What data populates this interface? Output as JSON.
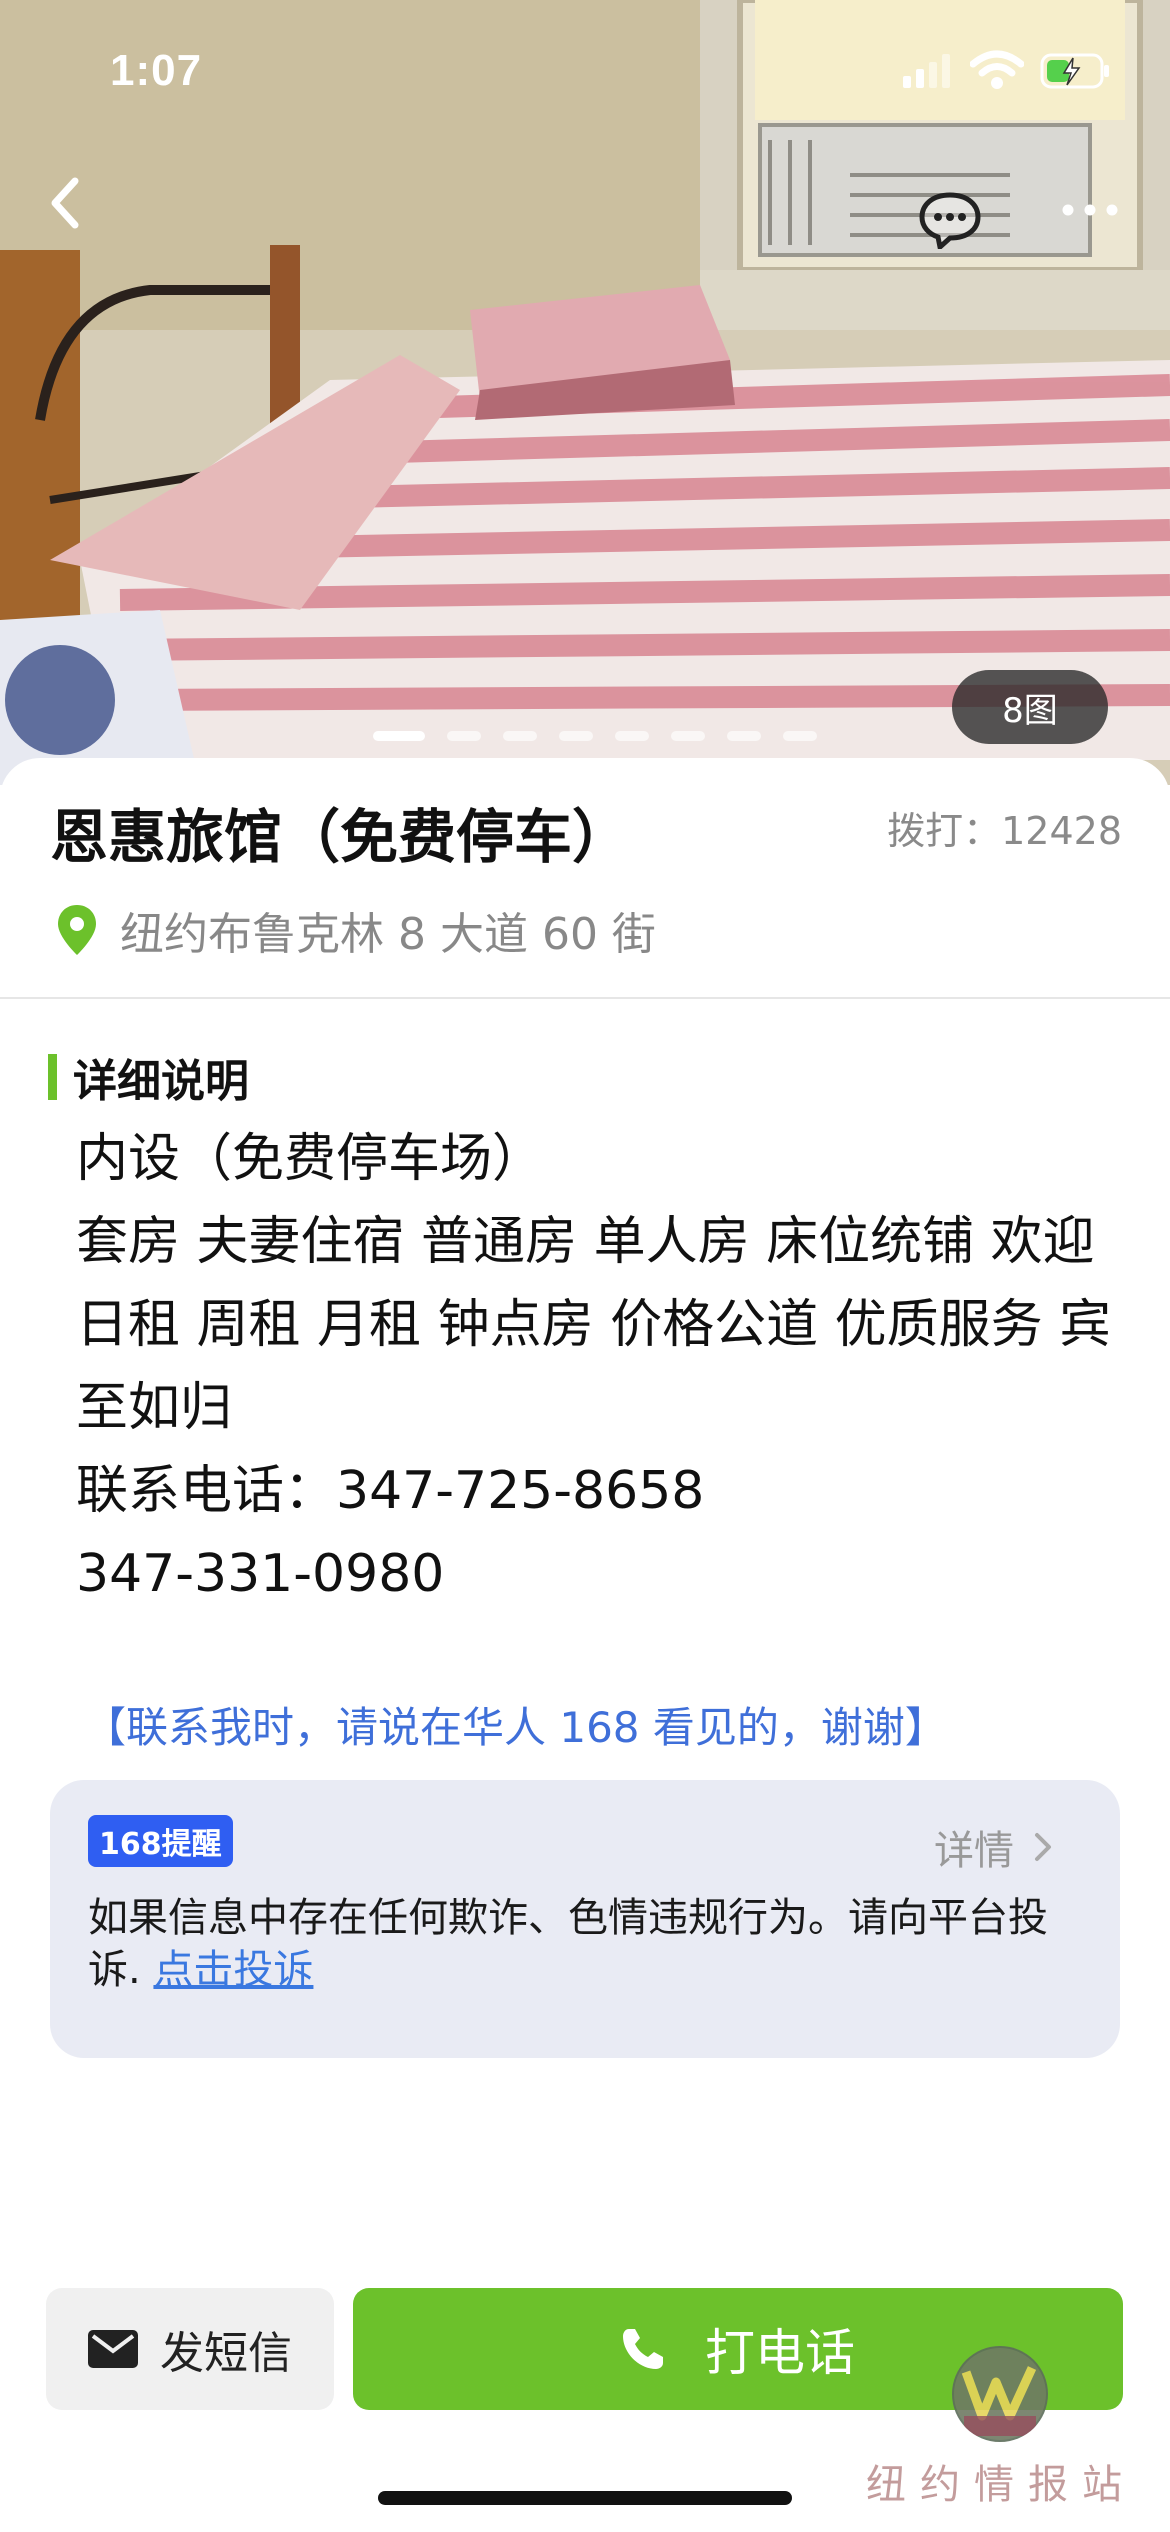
{
  "status_bar": {
    "time": "1:07"
  },
  "gallery": {
    "photo_count": "8图",
    "total_dots": 8,
    "active_dot": 1
  },
  "listing": {
    "title": "恩惠旅馆（免费停车）",
    "dial_count": "拨打：12428",
    "location": "纽约布鲁克林 8 大道 60 街"
  },
  "details": {
    "section_title": "详细说明",
    "lines": [
      "内设（免费停车场）",
      "套房 夫妻住宿 普通房 单人房 床位统铺 欢迎日租 周租 月租 钟点房 价格公道 优质服务 宾至如归",
      "联系电话：347-725-8658",
      "347-331-0980"
    ],
    "note": "【联系我时，请说在华人 168 看见的，谢谢】"
  },
  "alert": {
    "badge": "168提醒",
    "more_label": "详情",
    "message": "如果信息中存在任何欺诈、色情违规行为。请向平台投诉.",
    "link_label": "点击投诉"
  },
  "actions": {
    "sms_label": "发短信",
    "call_label": "打电话"
  },
  "watermark": {
    "text": "纽约情报站"
  },
  "colors": {
    "accent_green": "#6cc12b",
    "link_blue": "#3f6fd9",
    "badge_blue": "#2f5ef2"
  }
}
